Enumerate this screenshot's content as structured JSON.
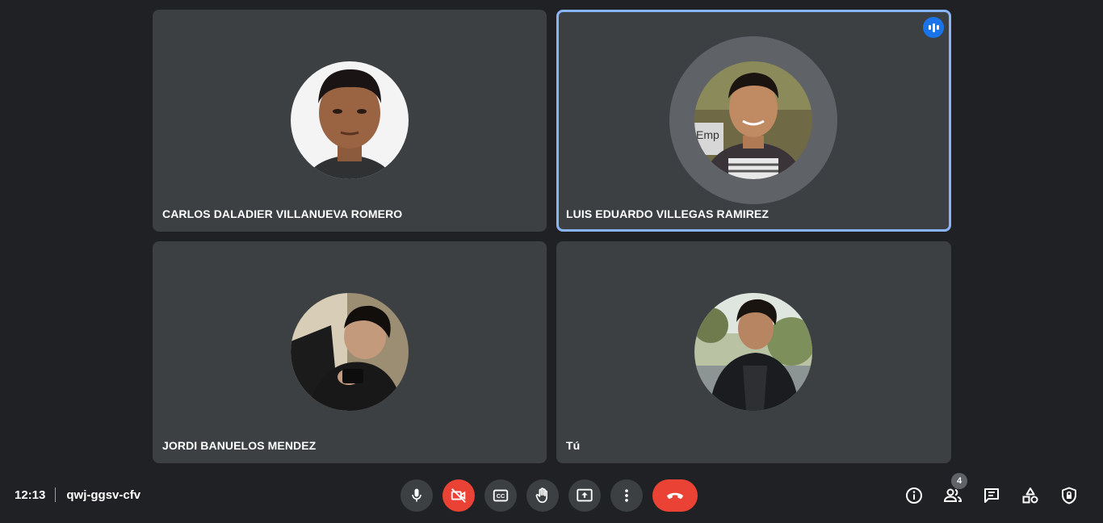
{
  "participants": [
    {
      "name": "CARLOS DALADIER VILLANUEVA ROMERO",
      "speaking": false
    },
    {
      "name": "LUIS EDUARDO VILLEGAS RAMIREZ",
      "speaking": true
    },
    {
      "name": "JORDI BANUELOS MENDEZ",
      "speaking": false
    },
    {
      "name": "Tú",
      "speaking": false
    }
  ],
  "meeting": {
    "time": "12:13",
    "code": "qwj-ggsv-cfv"
  },
  "people_count": "4",
  "icons": {
    "microphone": "microphone-icon",
    "camera_off": "camera-off-icon",
    "captions": "closed-captions-icon",
    "raise_hand": "raise-hand-icon",
    "present": "present-screen-icon",
    "more": "more-options-icon",
    "end_call": "end-call-icon",
    "info": "info-icon",
    "people": "people-icon",
    "chat": "chat-icon",
    "activities": "activities-icon",
    "host_controls": "host-controls-icon",
    "speaking": "speaking-icon"
  },
  "colors": {
    "background": "#202124",
    "tile": "#3c4043",
    "speaking_border": "#8ab4f8",
    "speaking_badge": "#1a73e8",
    "danger": "#ea4335"
  }
}
